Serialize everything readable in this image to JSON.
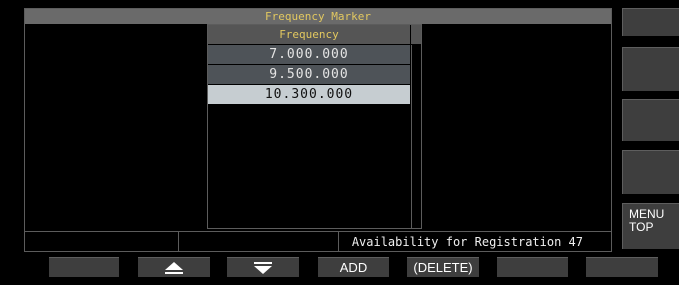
{
  "window": {
    "title": "Frequency Marker"
  },
  "list": {
    "header": "Frequency",
    "rows": [
      {
        "value": "7.000.000",
        "selected": false
      },
      {
        "value": "9.500.000",
        "selected": false
      },
      {
        "value": "10.300.000",
        "selected": true
      }
    ]
  },
  "status": {
    "availability": "Availability for Registration 47"
  },
  "side_buttons": [
    "",
    "",
    "",
    "",
    "MENU\nTOP"
  ],
  "bottom_buttons": [
    {
      "label": ""
    },
    {
      "label": "",
      "icon": "triangle-up-icon"
    },
    {
      "label": "",
      "icon": "triangle-down-icon"
    },
    {
      "label": "ADD"
    },
    {
      "label": "(DELETE)"
    },
    {
      "label": ""
    },
    {
      "label": ""
    }
  ],
  "colors": {
    "title_text": "#e2c860",
    "selected_row": "#c6cdd1",
    "row_bg": "#4e5358"
  }
}
